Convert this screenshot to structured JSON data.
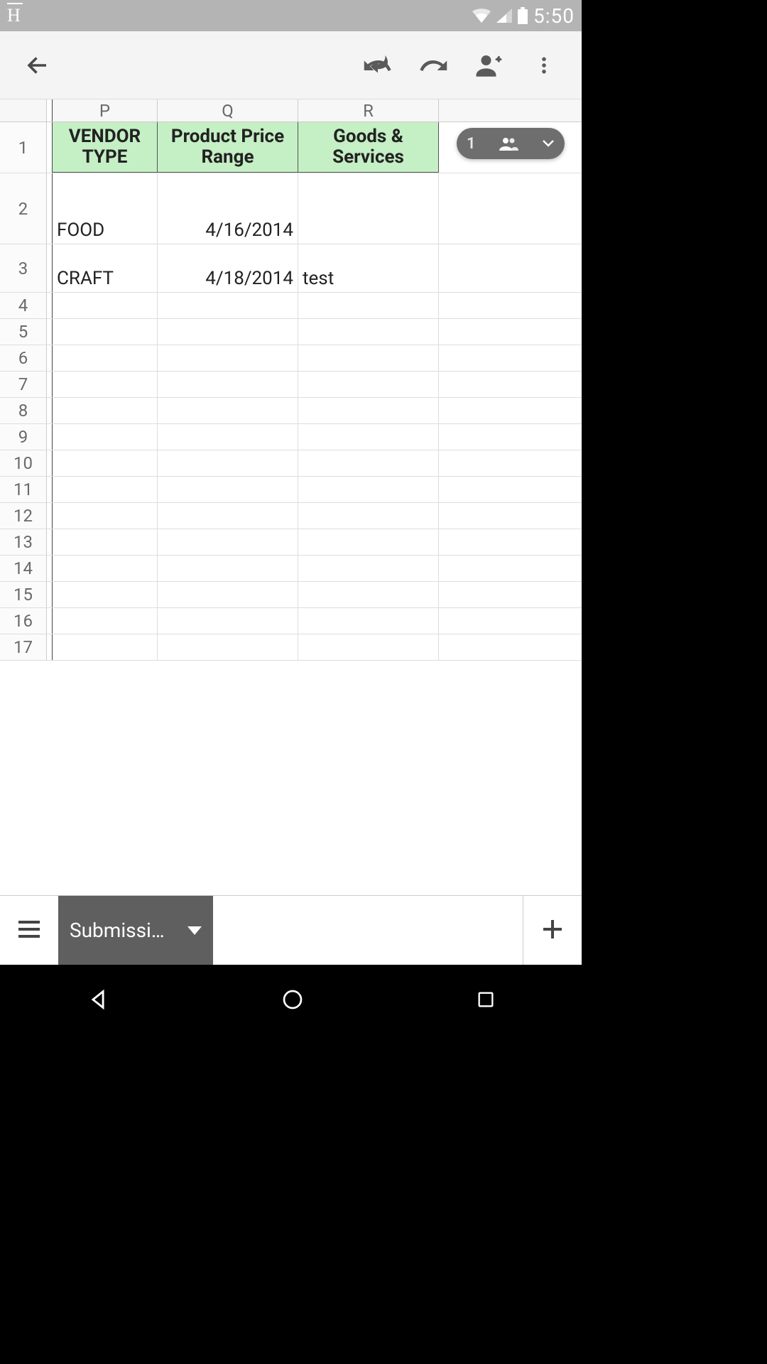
{
  "status": {
    "left_indicator": "H",
    "time": "5:50"
  },
  "toolbar": {
    "back": "Back",
    "undo": "Undo",
    "redo": "Redo",
    "share": "Add person",
    "overflow": "More options"
  },
  "columns": {
    "P": "P",
    "Q": "Q",
    "R": "R"
  },
  "header_row": {
    "P": "VENDOR TYPE",
    "Q": "Product Price Range",
    "R": "Goods & Services"
  },
  "rows": [
    {
      "n": "1"
    },
    {
      "n": "2",
      "P": "FOOD",
      "Q": "4/16/2014",
      "R": ""
    },
    {
      "n": "3",
      "P": "CRAFT",
      "Q": "4/18/2014",
      "R": "test"
    },
    {
      "n": "4"
    },
    {
      "n": "5"
    },
    {
      "n": "6"
    },
    {
      "n": "7"
    },
    {
      "n": "8"
    },
    {
      "n": "9"
    },
    {
      "n": "10"
    },
    {
      "n": "11"
    },
    {
      "n": "12"
    },
    {
      "n": "13"
    },
    {
      "n": "14"
    },
    {
      "n": "15"
    },
    {
      "n": "16"
    },
    {
      "n": "17"
    }
  ],
  "float_chip": {
    "count": "1"
  },
  "tabs": {
    "active_sheet": "Submissi…"
  }
}
